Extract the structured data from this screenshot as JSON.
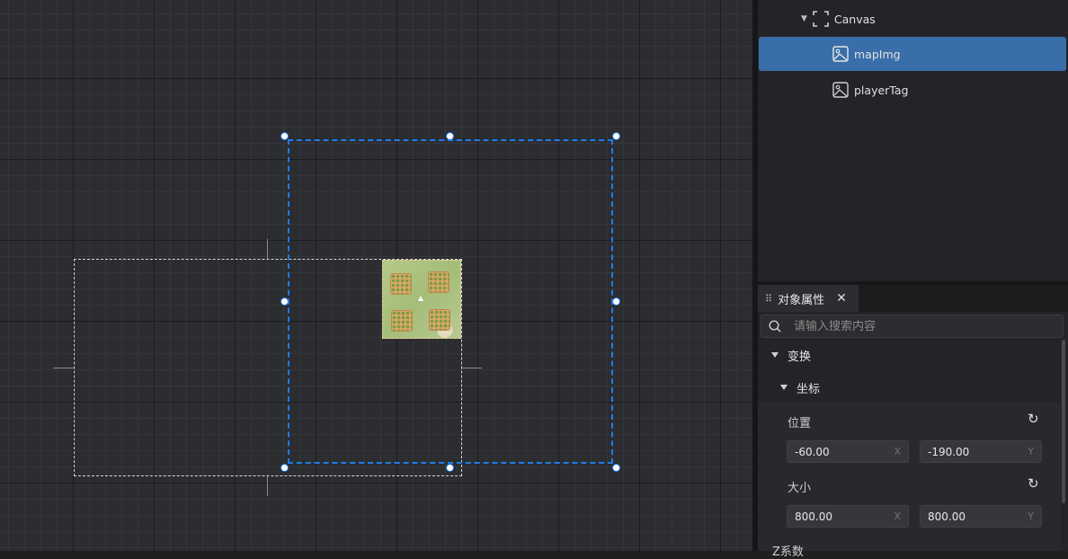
{
  "hierarchy": {
    "items": [
      {
        "label": "Canvas",
        "icon": "frame-icon",
        "expanded": true,
        "selected": false
      },
      {
        "label": "mapImg",
        "icon": "image-icon",
        "selected": true
      },
      {
        "label": "playerTag",
        "icon": "image-icon",
        "selected": false
      }
    ]
  },
  "properties": {
    "tab_title": "对象属性",
    "search_placeholder": "请输入搜索内容",
    "transform_label": "变换",
    "coords_label": "坐标",
    "position": {
      "label": "位置",
      "x": "-60.00",
      "y": "-190.00",
      "x_axis": "X",
      "y_axis": "Y"
    },
    "size": {
      "label": "大小",
      "x": "800.00",
      "y": "800.00",
      "x_axis": "X",
      "y_axis": "Y"
    },
    "z_label": "Z系数"
  },
  "colors": {
    "selection": "#1f7cf0",
    "selected_row": "#3a6eaa",
    "panel_bg": "#232427",
    "viewport_bg": "#2b2d30"
  }
}
